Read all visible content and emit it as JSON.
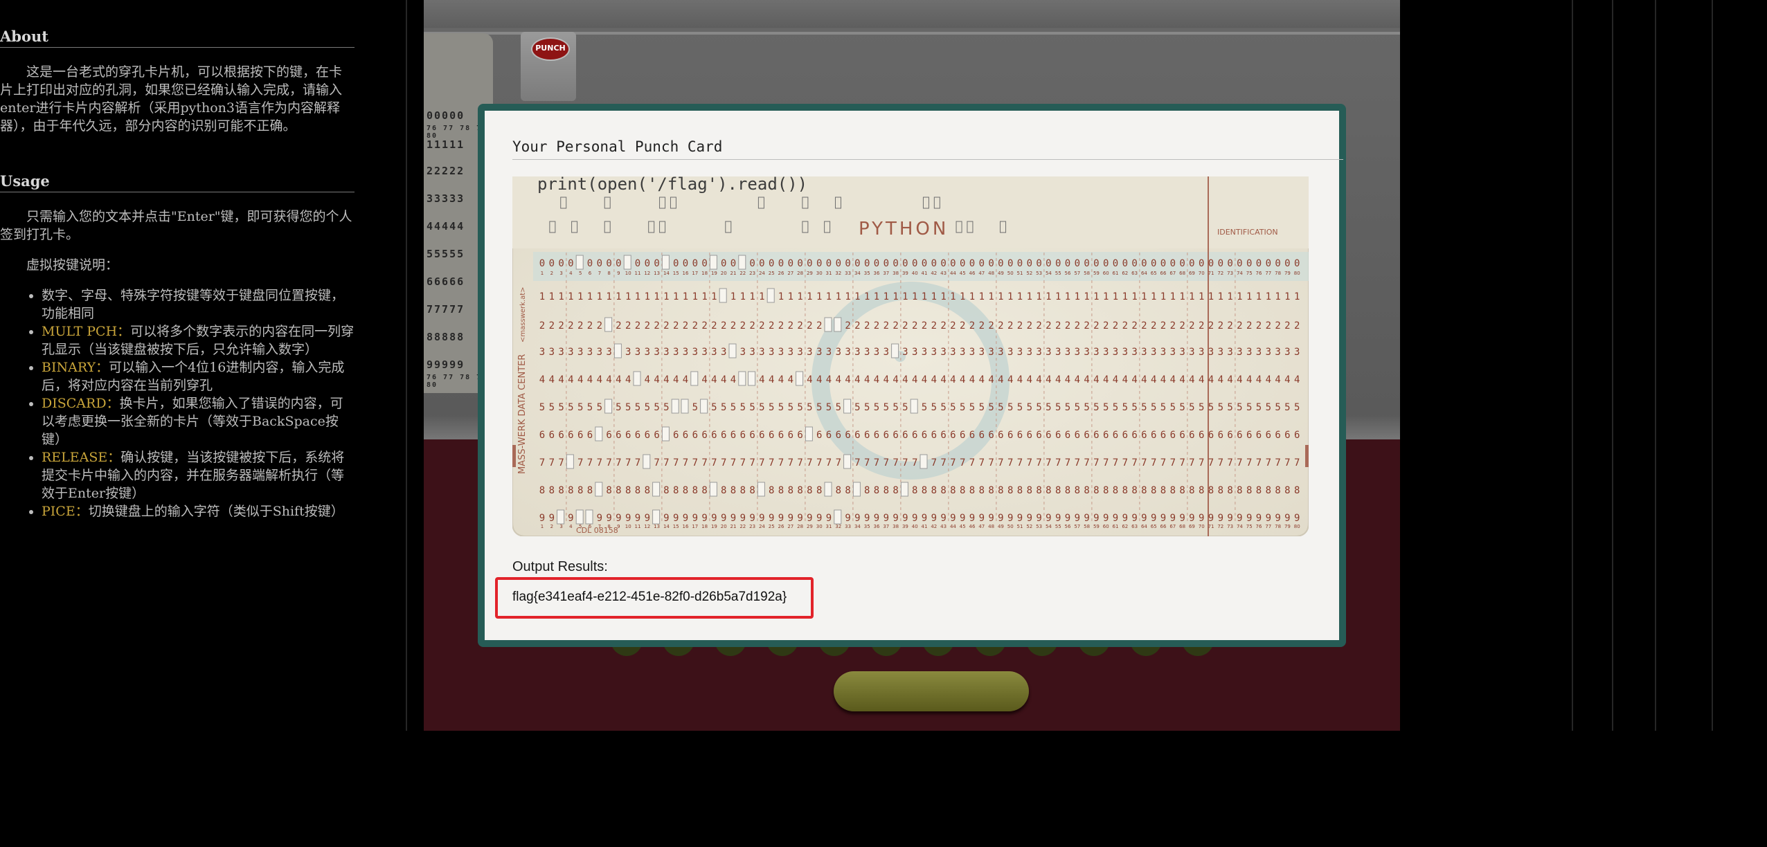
{
  "about": {
    "heading": "About",
    "text": "这是一台老式的穿孔卡片机，可以根据按下的键，在卡片上打印出对应的孔洞，如果您已经确认输入完成，请输入enter进行卡片内容解析（采用python3语言作为内容解释器），由于年代久远，部分内容的识别可能不正确。"
  },
  "usage": {
    "heading": "Usage",
    "text": "只需输入您的文本并点击\"Enter\"键，即可获得您的个人签到打孔卡。",
    "subheading": "虚拟按键说明：",
    "items": [
      {
        "key": "",
        "desc": "数字、字母、特殊字符按键等效于键盘同位置按键，功能相同"
      },
      {
        "key": "MULT PCH：",
        "desc": "可以将多个数字表示的内容在同一列穿孔显示（当该键盘被按下后，只允许输入数字）"
      },
      {
        "key": "BINARY：",
        "desc": "可以输入一个4位16进制内容，输入完成后，将对应内容在当前列穿孔"
      },
      {
        "key": "DISCARD：",
        "desc": "换卡片，如果您输入了错误的内容，可以考虑更换一张全新的卡片（等效于BackSpace按键）"
      },
      {
        "key": "RELEASE：",
        "desc": "确认按键，当该按键被按下后，系统将提交卡片中输入的内容，并在服务器端解析执行（等效于Enter按键）"
      },
      {
        "key": "PICE：",
        "desc": "切换键盘上的输入字符（类似于Shift按键）"
      }
    ]
  },
  "machine": {
    "punch_button": "PUNCH",
    "stack_rows": [
      "00000",
      "76 77 78 79 80",
      "11111",
      "22222",
      "33333",
      "44444",
      "55555",
      "66666",
      "77777",
      "88888",
      "99999",
      "76 77 78 79 80"
    ]
  },
  "modal": {
    "title": "Your Personal Punch Card",
    "card": {
      "printed_code": "print(open('/flag').read())",
      "language_label": "PYTHON",
      "identification_label": "IDENTIFICATION",
      "side_label": "MASS-WERK DATA CENTER",
      "side_brand": "<masswerk.at>",
      "footer_label": "CDL   08158",
      "digits": [
        "0",
        "1",
        "2",
        "3",
        "4",
        "5",
        "6",
        "7",
        "8",
        "9"
      ]
    },
    "output_label": "Output Results:",
    "output_value": "flag{e341eaf4-e212-451e-82f0-d26b5a7d192a}"
  },
  "colors": {
    "modal_frame": "#265c56",
    "card_ink": "#8a3a2a",
    "highlight_box": "#e2232a",
    "panel_bottom": "#3d1118"
  }
}
